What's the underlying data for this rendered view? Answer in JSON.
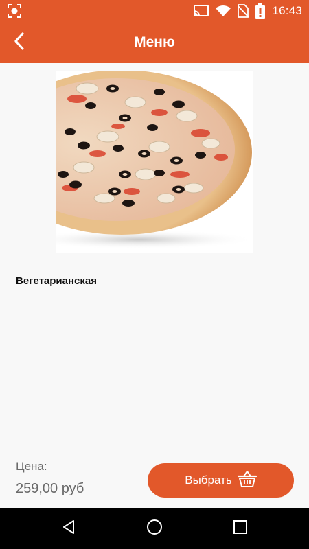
{
  "status_bar": {
    "time": "16:43",
    "icons": [
      "screenshot-icon",
      "cast-icon",
      "wifi-icon",
      "no-sim-icon",
      "battery-icon"
    ]
  },
  "app_bar": {
    "title": "Меню",
    "back_icon": "chevron-left-icon"
  },
  "product": {
    "image": "pizza-photo",
    "name": "Вегетарианская",
    "price_label": "Цена:",
    "price_value": "259,00 руб"
  },
  "action": {
    "choose_label": "Выбрать",
    "icon": "basket-icon"
  },
  "nav_bar": {
    "buttons": [
      "back-triangle-icon",
      "home-circle-icon",
      "recents-square-icon"
    ]
  },
  "colors": {
    "accent": "#e2582a",
    "background": "#f8f8f8",
    "text_dark": "#111111",
    "text_muted": "#6a6a6a"
  }
}
